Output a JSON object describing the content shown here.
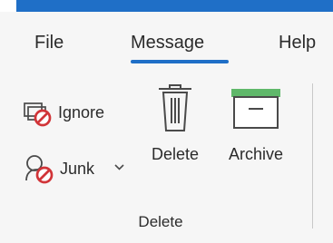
{
  "ribbon": {
    "tabs": [
      {
        "label": "File"
      },
      {
        "label": "Message",
        "selected": true
      },
      {
        "label": "Help"
      }
    ],
    "group": {
      "label": "Delete",
      "commands": {
        "ignore": {
          "label": "Ignore",
          "icon": "ignore-icon"
        },
        "junk": {
          "label": "Junk",
          "icon": "junk-icon",
          "dropdown_icon": "chevron-down-icon"
        },
        "delete": {
          "label": "Delete",
          "icon": "trash-icon"
        },
        "archive": {
          "label": "Archive",
          "icon": "archive-icon"
        }
      }
    }
  },
  "colors": {
    "accent": "#1f6fc7",
    "warning": "#d13438",
    "archive": "#5fb86a"
  }
}
